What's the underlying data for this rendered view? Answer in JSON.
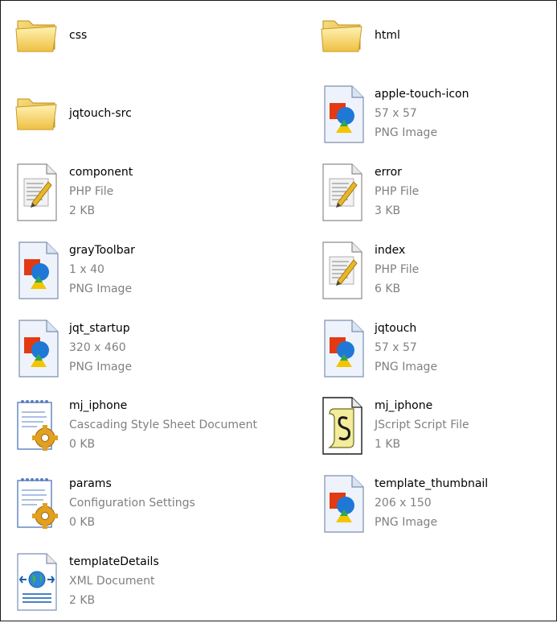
{
  "items": [
    {
      "name": "css",
      "lines": [],
      "icon": "folder-icon"
    },
    {
      "name": "html",
      "lines": [],
      "icon": "folder-icon"
    },
    {
      "name": "jqtouch-src",
      "lines": [],
      "icon": "folder-icon"
    },
    {
      "name": "apple-touch-icon",
      "lines": [
        "57 x 57",
        "PNG Image"
      ],
      "icon": "png-image-icon"
    },
    {
      "name": "component",
      "lines": [
        "PHP File",
        "2 KB"
      ],
      "icon": "php-file-icon"
    },
    {
      "name": "error",
      "lines": [
        "PHP File",
        "3 KB"
      ],
      "icon": "php-file-icon"
    },
    {
      "name": "grayToolbar",
      "lines": [
        "1 x 40",
        "PNG Image"
      ],
      "icon": "png-image-icon"
    },
    {
      "name": "index",
      "lines": [
        "PHP File",
        "6 KB"
      ],
      "icon": "php-file-icon"
    },
    {
      "name": "jqt_startup",
      "lines": [
        "320 x 460",
        "PNG Image"
      ],
      "icon": "png-image-icon"
    },
    {
      "name": "jqtouch",
      "lines": [
        "57 x 57",
        "PNG Image"
      ],
      "icon": "png-image-icon"
    },
    {
      "name": "mj_iphone",
      "lines": [
        "Cascading Style Sheet Document",
        "0 KB"
      ],
      "icon": "css-document-icon"
    },
    {
      "name": "mj_iphone",
      "lines": [
        "JScript Script File",
        "1 KB"
      ],
      "icon": "jscript-file-icon"
    },
    {
      "name": "params",
      "lines": [
        "Configuration Settings",
        "0 KB"
      ],
      "icon": "config-settings-icon"
    },
    {
      "name": "template_thumbnail",
      "lines": [
        "206 x 150",
        "PNG Image"
      ],
      "icon": "png-image-icon"
    },
    {
      "name": "templateDetails",
      "lines": [
        "XML Document",
        "2 KB"
      ],
      "icon": "xml-document-icon"
    }
  ],
  "colors": {
    "background": "#ffffff",
    "name_text": "#000000",
    "meta_text": "#808080",
    "folder_yellow": "#f6d25c"
  }
}
